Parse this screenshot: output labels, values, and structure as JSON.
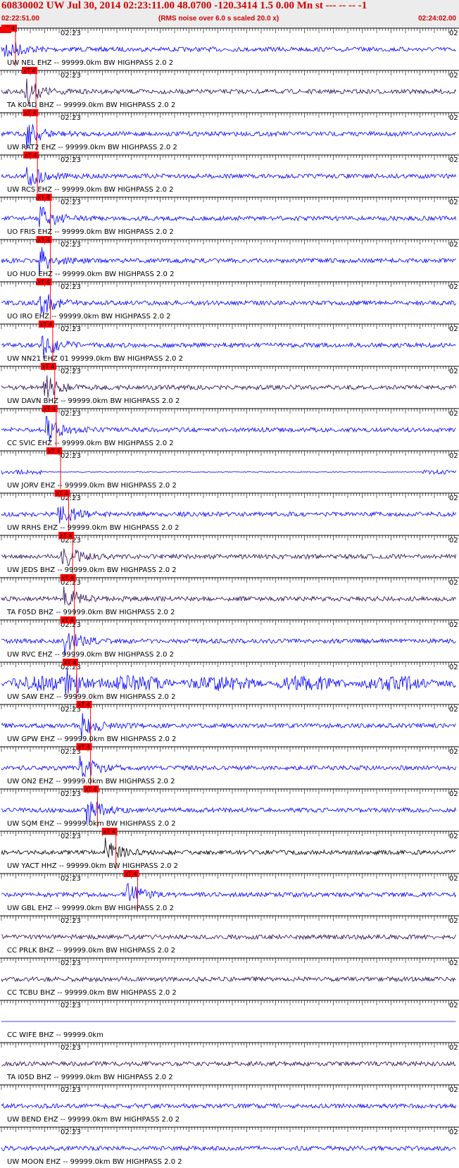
{
  "header": {
    "title": "60830002 UW Jul 30, 2014 02:23:11.00   48.0700 -120.3414  1.5 0.00 Mn st --- -- --  -1",
    "start_time": "02:22:51.00",
    "rms_note": "(RMS noise over 6.0 s scaled 20.0 x)",
    "end_time": "02:24:02.00"
  },
  "minute_label": "02:23",
  "edge_label": "02",
  "pick_label": "xT 4",
  "colors": {
    "title_text": "#d40000",
    "trace_blue": "#0000ff",
    "trace_dark": "#2a0a55",
    "trace_black": "#000000",
    "pick": "#ff0000",
    "title_bg": "#ececec"
  },
  "traces": [
    {
      "label": "UW NEL EHZ -- 99999.0km BW  HIGHPASS  2.0  2",
      "color": "blue",
      "pick_time": 0.0
    },
    {
      "label": "TA K04D BHZ -- 99999.0km BW  HIGHPASS  2.0  2",
      "color": "dark",
      "pick_time": 7.1
    },
    {
      "label": "UW RAT2 EHZ -- 99999.0km BW  HIGHPASS  2.0  2",
      "color": "blue",
      "pick_time": 7.4
    },
    {
      "label": "UW RCS EHZ -- 99999.0km BW  HIGHPASS  2.0  2",
      "color": "blue",
      "pick_time": 7.6
    },
    {
      "label": "UO FRIS EHZ -- 99999.0km BW  HIGHPASS  2.0  2",
      "color": "blue",
      "pick_time": 12.1
    },
    {
      "label": "UO HUO EHZ -- 99999.0km BW  HIGHPASS  2.0  2",
      "color": "blue",
      "pick_time": 12.1
    },
    {
      "label": "UO IRO EHZ -- 99999.0km BW  HIGHPASS  2.0  2",
      "color": "blue",
      "pick_time": 12.1
    },
    {
      "label": "UW NN21 EHZ 01 99999.0km BW  HIGHPASS  2.0  2",
      "color": "blue",
      "pick_time": 12.9
    },
    {
      "label": "UW DAVN BHZ -- 99999.0km BW  HIGHPASS  2.0  2",
      "color": "dark",
      "pick_time": 13.6
    },
    {
      "label": "CC SVIC EHZ -- 99999.0km BW  HIGHPASS  2.0  2",
      "color": "blue",
      "pick_time": 14.1
    },
    {
      "label": "UW JORV EHZ -- 99999.0km BW  HIGHPASS  2.0  2",
      "color": "blue",
      "pick_time": 15.6
    },
    {
      "label": "UW RRHS EHZ -- 99999.0km BW  HIGHPASS  2.0  2",
      "color": "blue",
      "pick_time": 18.4
    },
    {
      "label": "UW JEDS BHZ -- 99999.0km BW  HIGHPASS  2.0  2",
      "color": "dark",
      "pick_time": 19.8
    },
    {
      "label": "TA F05D BHZ -- 99999.0km BW  HIGHPASS  2.0  2",
      "color": "dark",
      "pick_time": 20.4
    },
    {
      "label": "UW RVC EHZ -- 99999.0km BW  HIGHPASS  2.0  2",
      "color": "blue",
      "pick_time": 20.4
    },
    {
      "label": "UW SAW EHZ -- 99999.0km BW  HIGHPASS  2.0  2",
      "color": "blue",
      "pick_time": 21.2
    },
    {
      "label": "UW GPW EHZ -- 99999.0km BW  HIGHPASS  2.0  2",
      "color": "blue",
      "pick_time": 26.0
    },
    {
      "label": "UW ON2 EHZ -- 99999.0km BW  HIGHPASS  2.0  2",
      "color": "blue",
      "pick_time": 26.0
    },
    {
      "label": "UW SQM EHZ -- 99999.0km BW  HIGHPASS  2.0  2",
      "color": "blue",
      "pick_time": 28.4
    },
    {
      "label": "UW YACT HHZ -- 99999.0km BW  HIGHPASS  2.0  2",
      "color": "black",
      "pick_time": 34.8
    },
    {
      "label": "UW GBL EHZ -- 99999.0km BW  HIGHPASS  2.0  2",
      "color": "blue",
      "pick_time": 42.3
    },
    {
      "label": "CC PRLK BHZ -- 99999.0km BW  HIGHPASS  2.0  2",
      "color": "dark",
      "pick_time": null
    },
    {
      "label": "CC TCBU BHZ -- 99999.0km BW  HIGHPASS  2.0  2",
      "color": "dark",
      "pick_time": null
    },
    {
      "label": "CC WIFE BHZ -- 99999.0km",
      "color": "blue",
      "pick_time": null
    },
    {
      "label": "TA I05D BHZ -- 99999.0km BW  HIGHPASS  2.0  2",
      "color": "dark",
      "pick_time": null
    },
    {
      "label": "UW BEND EHZ -- 99999.0km BW  HIGHPASS  2.0  2",
      "color": "blue",
      "pick_time": null
    },
    {
      "label": "UW MOON EHZ -- 99999.0km BW  HIGHPASS  2.0  2",
      "color": "blue",
      "pick_time": null
    }
  ]
}
